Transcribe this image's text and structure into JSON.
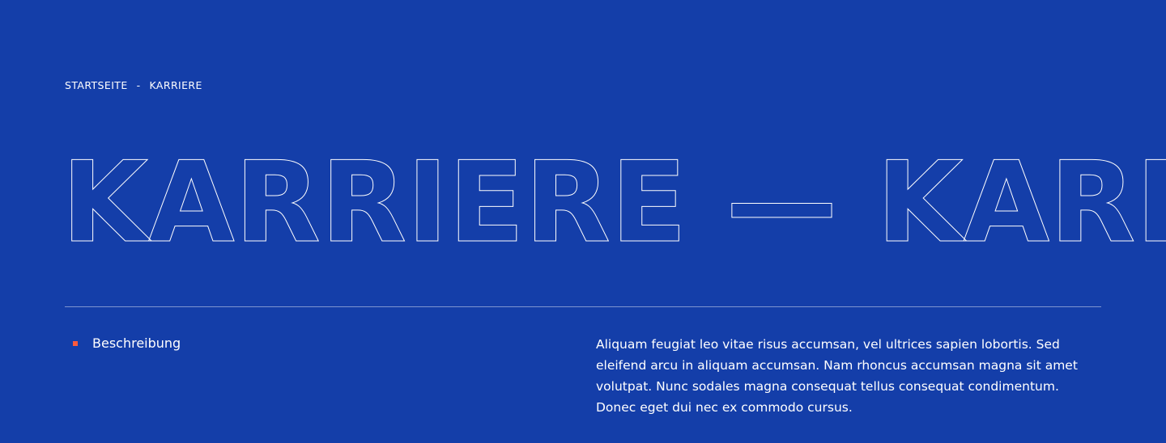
{
  "breadcrumb": {
    "home_label": "STARTSEITE",
    "separator": "-",
    "current_label": "KARRIERE"
  },
  "hero": {
    "marquee_text": "KARRIERE — KARRIERE — KARRIERE"
  },
  "section": {
    "label": "Beschreibung",
    "description": "Aliquam feugiat leo vitae risus accumsan, vel ultrices sapien lobortis. Sed eleifend arcu in aliquam accumsan. Nam rhoncus accumsan magna sit amet volutpat. Nunc sodales magna consequat tellus consequat condimentum. Donec eget dui nec ex commodo cursus."
  },
  "colors": {
    "background": "#143ea9",
    "text": "#ffffff",
    "accent": "#ff5a3c"
  }
}
